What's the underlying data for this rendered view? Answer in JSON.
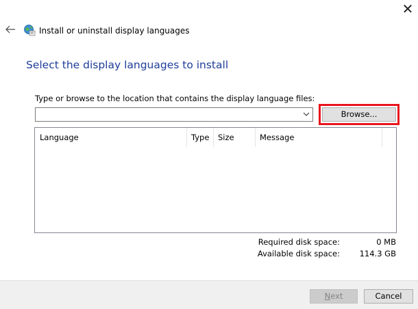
{
  "window": {
    "close_glyph": "✕",
    "title": "Install or uninstall display languages"
  },
  "icons": {
    "back": "back-arrow-icon",
    "wizard": "globe-language-icon",
    "close": "close-icon",
    "dropdown": "chevron-down-icon"
  },
  "main": {
    "heading": "Select the display languages to install",
    "instruction": "Type or browse to the location that contains the display language files:",
    "path_input": {
      "value": "",
      "placeholder": ""
    },
    "browse_label": "Browse...",
    "list": {
      "columns": [
        "Language",
        "Type",
        "Size",
        "Message"
      ],
      "rows": []
    },
    "disk": {
      "required_label": "Required disk space:",
      "required_value": "0 MB",
      "available_label": "Available disk space:",
      "available_value": "114.3 GB"
    }
  },
  "footer": {
    "next_label": "Next",
    "cancel_label": "Cancel"
  },
  "colors": {
    "heading": "#1f3d99",
    "highlight": "#e8141c",
    "footer_bg": "#f0f0f0"
  }
}
